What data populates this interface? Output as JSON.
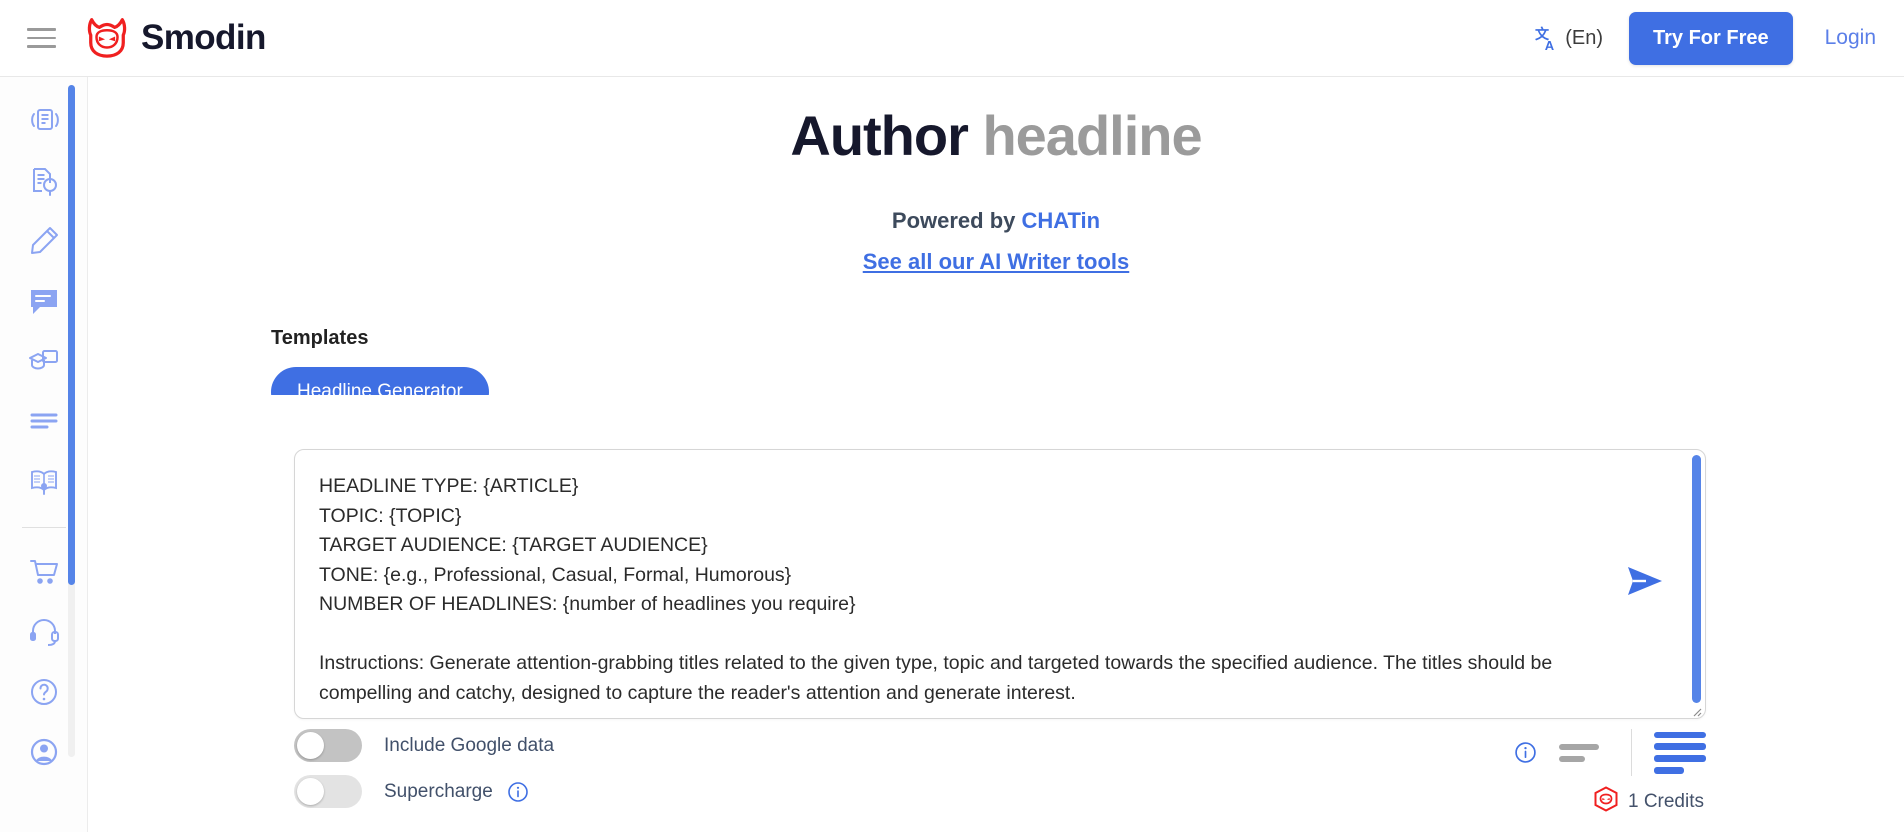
{
  "header": {
    "menu_icon": "hamburger-menu-icon",
    "logo_icon": "smodin-mask-logo-icon",
    "brand": "Smodin",
    "language_icon": "translate-icon",
    "language_label": "(En)",
    "try_free_label": "Try For Free",
    "login_label": "Login",
    "accent_color": "#3f6fe3"
  },
  "sidebar": {
    "items": [
      {
        "name": "rewriter",
        "icon": "document-rewrite-icon"
      },
      {
        "name": "plagiarism-checker",
        "icon": "document-search-icon"
      },
      {
        "name": "ai-writer",
        "icon": "pencil-icon"
      },
      {
        "name": "chat",
        "icon": "chat-bubble-icon"
      },
      {
        "name": "homework-helper",
        "icon": "graduation-screen-icon"
      },
      {
        "name": "summarizer",
        "icon": "text-lines-icon"
      },
      {
        "name": "translator",
        "icon": "open-book-icon"
      },
      {
        "name": "pricing",
        "icon": "shopping-cart-icon"
      },
      {
        "name": "support",
        "icon": "headset-icon"
      },
      {
        "name": "help",
        "icon": "question-circle-icon"
      },
      {
        "name": "account",
        "icon": "user-circle-icon"
      }
    ]
  },
  "main": {
    "title_strong": "Author",
    "title_muted": "headline",
    "powered_prefix": "Powered by ",
    "powered_brand": "CHATin",
    "tools_link": "See all our AI Writer tools",
    "templates_label": "Templates",
    "templates": [
      {
        "label": "Headline Generator",
        "selected": true
      }
    ]
  },
  "prompt": {
    "value": "HEADLINE TYPE: {ARTICLE}\nTOPIC: {TOPIC}\nTARGET AUDIENCE: {TARGET AUDIENCE}\nTONE: {e.g., Professional, Casual, Formal, Humorous}\nNUMBER OF HEADLINES: {number of headlines you require}\n\nInstructions: Generate attention-grabbing titles related to the given type, topic and targeted towards the specified audience. The titles should be compelling and catchy, designed to capture the reader's attention and generate interest.",
    "send_icon": "send-paper-plane-icon",
    "scrollbar_color": "#5584e8"
  },
  "controls": {
    "toggles": [
      {
        "label": "Include Google data",
        "state": "off",
        "has_info": false
      },
      {
        "label": "Supercharge",
        "state": "off",
        "has_info": true
      }
    ],
    "info_icon": "info-circle-icon",
    "length_short_icon": "short-output-icon",
    "length_long_icon": "long-output-icon",
    "length_selected": "long",
    "credits_icon": "smodin-credit-badge-icon",
    "credits_text": "1 Credits"
  }
}
